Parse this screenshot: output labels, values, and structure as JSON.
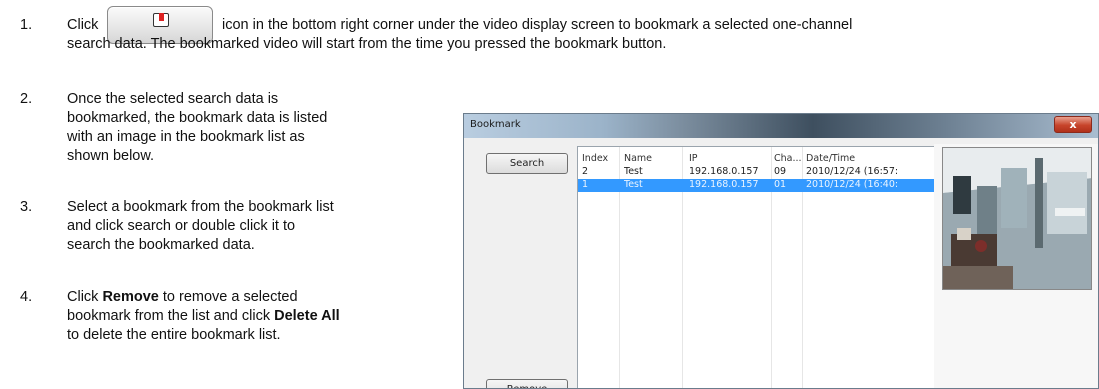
{
  "steps": [
    {
      "number": "1.",
      "pre": "Click",
      "line1_after": "icon in the bottom right corner under the video display screen to bookmark a selected one-channel",
      "line2": "search data. The bookmarked video will start from the time you pressed the bookmark button."
    },
    {
      "number": "2.",
      "lines": [
        "Once the selected search data is",
        "bookmarked, the bookmark data is listed",
        "with an image in the bookmark list as",
        "shown below."
      ]
    },
    {
      "number": "3.",
      "lines": [
        "Select a bookmark from the bookmark list",
        "and click search or double click it to",
        "search the bookmarked data."
      ]
    },
    {
      "number": "4.",
      "line1_pre": "Click ",
      "line1_bold": "Remove",
      "line1_post": " to remove a selected",
      "line2_pre": "bookmark from the list and click ",
      "line2_bold": "Delete All",
      "line3": "to delete the entire bookmark list."
    }
  ],
  "icons": {
    "inline_button": "bookmark-icon",
    "close": "close-icon"
  },
  "dialog": {
    "title": "Bookmark",
    "close_label": "x",
    "search_button": "Search",
    "remove_button": "Remove",
    "columns": [
      "Index",
      "Name",
      "IP",
      "Cha...",
      "Date/Time"
    ],
    "rows": [
      {
        "index": "2",
        "name": "Test",
        "ip": "192.168.0.157",
        "channel": "09",
        "datetime": "2010/12/24 (16:57:",
        "selected": false
      },
      {
        "index": "1",
        "name": "Test",
        "ip": "192.168.0.157",
        "channel": "01",
        "datetime": "2010/12/24 (16:40:",
        "selected": true
      }
    ]
  },
  "colors": {
    "selection": "#3399ff",
    "close_button": "#c7442b"
  }
}
